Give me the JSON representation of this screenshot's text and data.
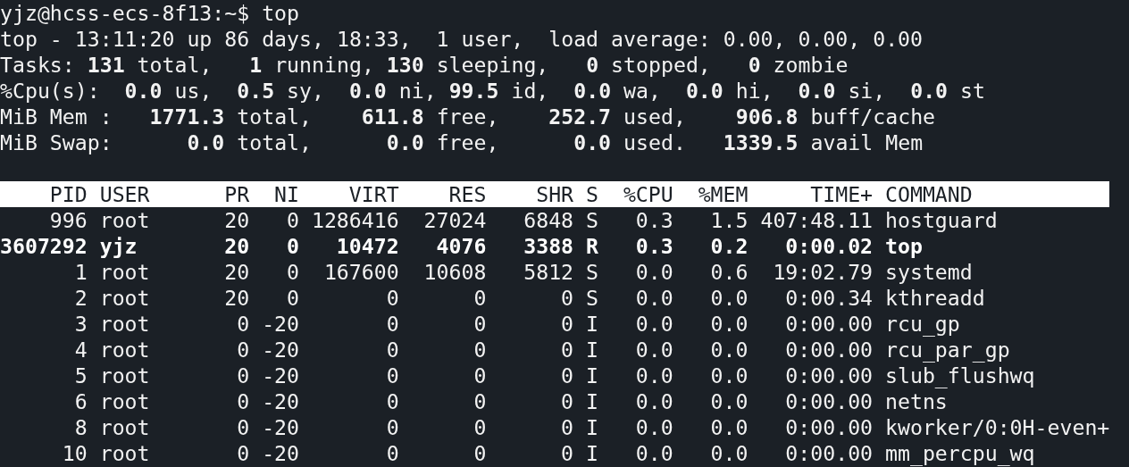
{
  "terminal": {
    "prompt": "yjz@hcss-ecs-8f13:~$ top",
    "summary": [
      "top - 13:11:20 up 86 days, 18:33,  1 user,  load average: 0.00, 0.00, 0.00",
      "Tasks: **131** total,   **1** running, **130** sleeping,   **0** stopped,   **0** zombie",
      "%Cpu(s):  **0.0** us,  **0.5** sy,  **0.0** ni, **99.5** id,  **0.0** wa,  **0.0** hi,  **0.0** si,  **0.0** st",
      "MiB Mem :   **1771.3** total,    **611.8** free,    **252.7** used,    **906.8** buff/cache",
      "MiB Swap:      **0.0** total,      **0.0** free,      **0.0** used.   **1339.5** avail Mem"
    ],
    "columns": [
      "PID",
      "USER",
      "PR",
      "NI",
      "VIRT",
      "RES",
      "SHR",
      "S",
      "%CPU",
      "%MEM",
      "TIME+",
      "COMMAND"
    ],
    "rows": [
      {
        "highlighted": false,
        "cells": [
          "996",
          "root",
          "20",
          "0",
          "1286416",
          "27024",
          "6848",
          "S",
          "0.3",
          "1.5",
          "407:48.11",
          "hostguard"
        ]
      },
      {
        "highlighted": true,
        "cells": [
          "3607292",
          "yjz",
          "20",
          "0",
          "10472",
          "4076",
          "3388",
          "R",
          "0.3",
          "0.2",
          "0:00.02",
          "top"
        ]
      },
      {
        "highlighted": false,
        "cells": [
          "1",
          "root",
          "20",
          "0",
          "167600",
          "10608",
          "5812",
          "S",
          "0.0",
          "0.6",
          "19:02.79",
          "systemd"
        ]
      },
      {
        "highlighted": false,
        "cells": [
          "2",
          "root",
          "20",
          "0",
          "0",
          "0",
          "0",
          "S",
          "0.0",
          "0.0",
          "0:00.34",
          "kthreadd"
        ]
      },
      {
        "highlighted": false,
        "cells": [
          "3",
          "root",
          "0",
          "-20",
          "0",
          "0",
          "0",
          "I",
          "0.0",
          "0.0",
          "0:00.00",
          "rcu_gp"
        ]
      },
      {
        "highlighted": false,
        "cells": [
          "4",
          "root",
          "0",
          "-20",
          "0",
          "0",
          "0",
          "I",
          "0.0",
          "0.0",
          "0:00.00",
          "rcu_par_gp"
        ]
      },
      {
        "highlighted": false,
        "cells": [
          "5",
          "root",
          "0",
          "-20",
          "0",
          "0",
          "0",
          "I",
          "0.0",
          "0.0",
          "0:00.00",
          "slub_flushwq"
        ]
      },
      {
        "highlighted": false,
        "cells": [
          "6",
          "root",
          "0",
          "-20",
          "0",
          "0",
          "0",
          "I",
          "0.0",
          "0.0",
          "0:00.00",
          "netns"
        ]
      },
      {
        "highlighted": false,
        "cells": [
          "8",
          "root",
          "0",
          "-20",
          "0",
          "0",
          "0",
          "I",
          "0.0",
          "0.0",
          "0:00.00",
          "kworker/0:0H-even+"
        ]
      },
      {
        "highlighted": false,
        "cells": [
          "10",
          "root",
          "0",
          "-20",
          "0",
          "0",
          "0",
          "I",
          "0.0",
          "0.0",
          "0:00.00",
          "mm_percpu_wq"
        ]
      }
    ]
  }
}
